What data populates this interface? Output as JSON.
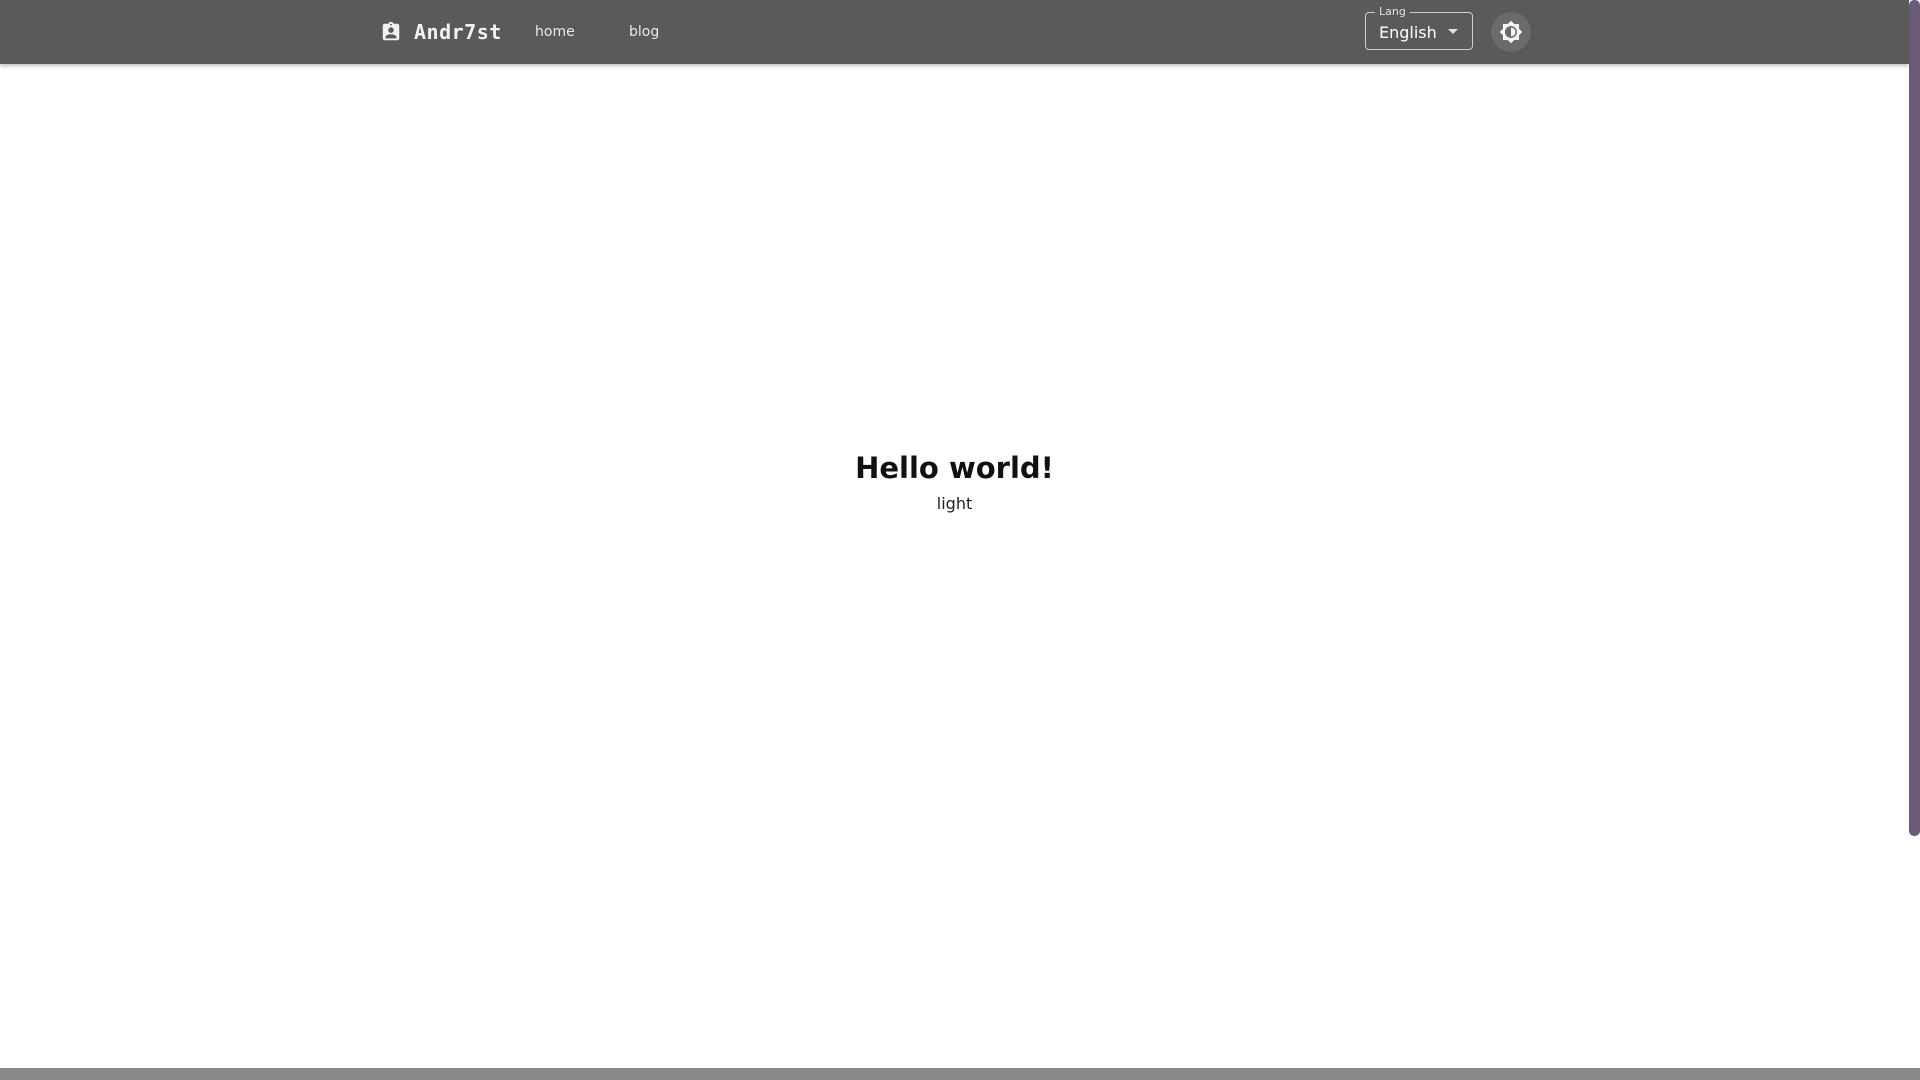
{
  "header": {
    "brand": {
      "name": "Andr7st",
      "icon": "contact-badge-icon"
    },
    "nav": [
      {
        "label": "home"
      },
      {
        "label": "blog"
      }
    ],
    "lang_select": {
      "legend": "Lang",
      "value": "English",
      "icon": "caret-down-icon"
    },
    "theme_toggle": {
      "icon": "brightness-icon"
    }
  },
  "main": {
    "title": "Hello world!",
    "subtitle": "light"
  },
  "colors": {
    "appbar": "#5a5a5a",
    "background": "#ffffff",
    "scrollbar_thumb": "#6a5a7a"
  }
}
